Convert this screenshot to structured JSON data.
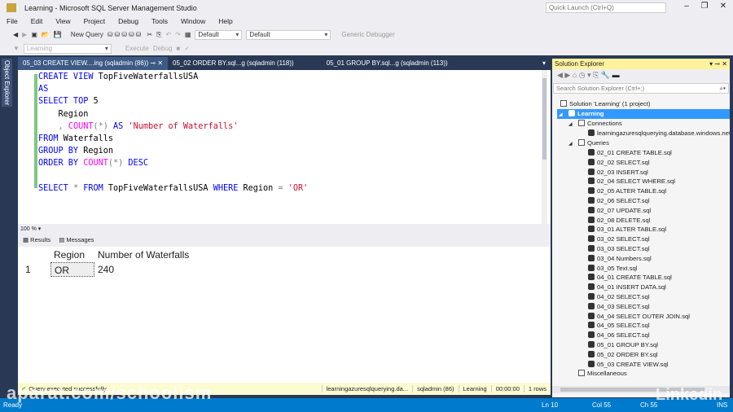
{
  "window": {
    "title": "Learning - Microsoft SQL Server Management Studio",
    "quick_launch": "Quick Launch (Ctrl+Q)"
  },
  "menu": [
    "File",
    "Edit",
    "View",
    "Project",
    "Debug",
    "Tools",
    "Window",
    "Help"
  ],
  "toolbar": {
    "new_query": "New Query",
    "config1": "Default",
    "config2": "Default",
    "debugger": "Generic Debugger",
    "database": "Learning",
    "execute": "Execute",
    "debug": "Debug"
  },
  "object_explorer": "Object Explorer",
  "tabs": [
    {
      "label": "05_03 CREATE VIEW....ing (sqladmin (86))",
      "active": true
    },
    {
      "label": "05_02 ORDER BY.sql...g (sqladmin (118))"
    },
    {
      "label": "05_01 GROUP BY.sql...g (sqladmin (113))"
    }
  ],
  "code": [
    [
      {
        "t": "CREATE VIEW ",
        "c": "kw"
      },
      {
        "t": "TopFiveWaterfallsUSA",
        "c": "id"
      }
    ],
    [
      {
        "t": "AS",
        "c": "kw"
      }
    ],
    [
      {
        "t": "SELECT TOP ",
        "c": "kw"
      },
      {
        "t": "5",
        "c": "id"
      }
    ],
    [
      {
        "t": "    Region",
        "c": "id"
      }
    ],
    [
      {
        "t": "    , ",
        "c": "op"
      },
      {
        "t": "COUNT",
        "c": "fn"
      },
      {
        "t": "(*) ",
        "c": "op"
      },
      {
        "t": "AS ",
        "c": "kw"
      },
      {
        "t": "'Number of Waterfalls'",
        "c": "str"
      }
    ],
    [
      {
        "t": "FROM ",
        "c": "kw"
      },
      {
        "t": "Waterfalls",
        "c": "id"
      }
    ],
    [
      {
        "t": "GROUP BY ",
        "c": "kw"
      },
      {
        "t": "Region",
        "c": "id"
      }
    ],
    [
      {
        "t": "ORDER BY ",
        "c": "kw"
      },
      {
        "t": "COUNT",
        "c": "fn"
      },
      {
        "t": "(*) ",
        "c": "op"
      },
      {
        "t": "DESC",
        "c": "kw"
      }
    ],
    [],
    [
      {
        "t": "SELECT ",
        "c": "kw"
      },
      {
        "t": "* ",
        "c": "op"
      },
      {
        "t": "FROM ",
        "c": "kw"
      },
      {
        "t": "TopFiveWaterfallsUSA ",
        "c": "id"
      },
      {
        "t": "WHERE ",
        "c": "kw"
      },
      {
        "t": "Region ",
        "c": "id"
      },
      {
        "t": "= ",
        "c": "op"
      },
      {
        "t": "'OR'",
        "c": "str"
      }
    ]
  ],
  "zoom": "100 %",
  "results_tabs": [
    "Results",
    "Messages"
  ],
  "grid": {
    "columns": [
      "Region",
      "Number of Waterfalls"
    ],
    "rows": [
      {
        "num": "1",
        "region": "OR",
        "count": "240"
      }
    ]
  },
  "status": {
    "message": "Query executed successfully.",
    "server": "learningazuresqlquerying.da...",
    "user": "sqladmin (86)",
    "db": "Learning",
    "time": "00:00:00",
    "rows": "1 rows"
  },
  "bottom": {
    "ready": "Ready",
    "ln": "Ln 10",
    "col": "Col 55",
    "ch": "Ch 55",
    "ins": "INS"
  },
  "solution_explorer": {
    "title": "Solution Explorer",
    "search": "Search Solution Explorer (Ctrl+;)",
    "solution": "Solution 'Learning' (1 project)",
    "project": "Learning",
    "connections": "Connections",
    "connection": "learningazuresqlquerying.database.windows.net",
    "queries": "Queries",
    "files": [
      "02_01 CREATE TABLE.sql",
      "02_02 SELECT.sql",
      "02_03 INSERT.sql",
      "02_04 SELECT WHERE.sql",
      "02_05 ALTER TABLE.sql",
      "02_06 SELECT.sql",
      "02_07 UPDATE.sql",
      "02_08 DELETE.sql",
      "03_01 ALTER TABLE.sql",
      "03_02 SELECT.sql",
      "03_03 SELECT.sql",
      "03_04 Numbers.sql",
      "03_05 Text.sql",
      "04_01 CREATE TABLE.sql",
      "04_01 INSERT DATA.sql",
      "04_02 SELECT.sql",
      "04_03 SELECT.sql",
      "04_04 SELECT OUTER JOIN.sql",
      "04_05 SELECT.sql",
      "04_06 SELECT.sql",
      "05_01 GROUP BY.sql",
      "05_02 ORDER BY.sql",
      "05_03 CREATE VIEW.sql"
    ],
    "misc": "Miscellaneous"
  },
  "watermarks": [
    "aparat.com/schoolism",
    "Linkedin"
  ]
}
